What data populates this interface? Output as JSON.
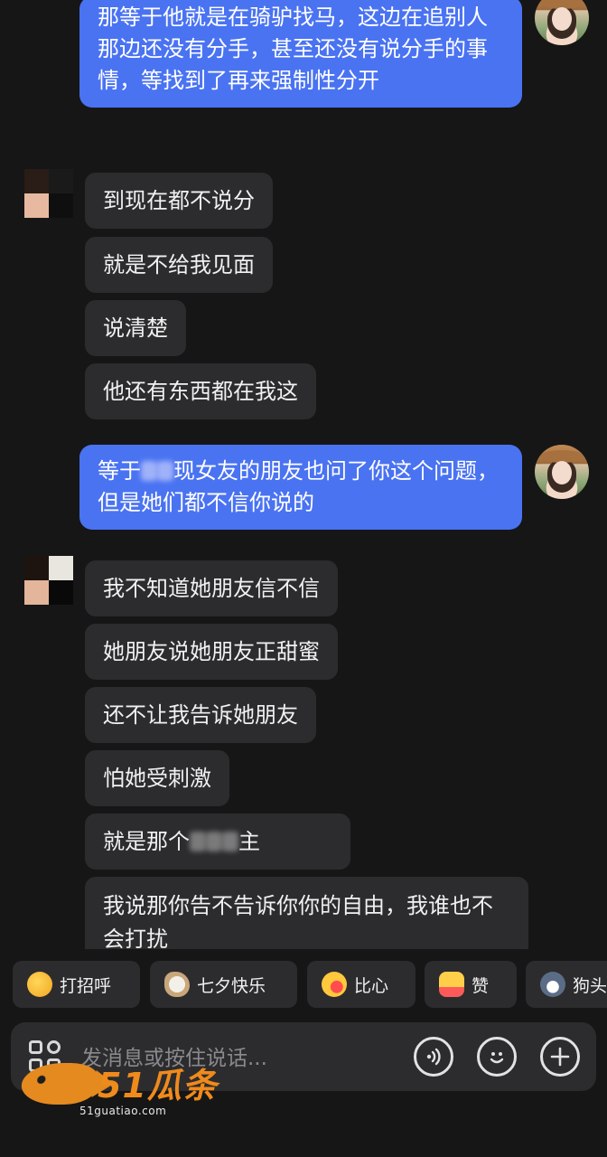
{
  "messages": [
    {
      "side": "out",
      "text": "那等于他就是在骑驴找马，这边在追别人那边还没有分手，甚至还没有说分手的事情，等找到了再来强制性分开"
    },
    {
      "side": "in",
      "text": "到现在都不说分"
    },
    {
      "side": "in",
      "text": "就是不给我见面"
    },
    {
      "side": "in",
      "text": "说清楚"
    },
    {
      "side": "in",
      "text": "他还有东西都在我这"
    },
    {
      "side": "out",
      "text_before": "等于",
      "text_after": "现女友的朋友也问了你这个问题，但是她们都不信你说的"
    },
    {
      "side": "in",
      "text": "我不知道她朋友信不信"
    },
    {
      "side": "in",
      "text": "她朋友说她朋友正甜蜜"
    },
    {
      "side": "in",
      "text": "还不让我告诉她朋友"
    },
    {
      "side": "in",
      "text": "怕她受刺激"
    },
    {
      "side": "in",
      "text_before": "就是那个",
      "text_after": "主"
    },
    {
      "side": "in",
      "text": "我说那你告不告诉你你的自由，我谁也不会打扰"
    }
  ],
  "quick_replies": [
    {
      "label": "打招呼",
      "icon": "smile-wave-icon"
    },
    {
      "label": "七夕快乐",
      "icon": "bird-icon"
    },
    {
      "label": "比心",
      "icon": "heart-hand-icon"
    },
    {
      "label": "赞",
      "icon": "thumbs-up-icon"
    },
    {
      "label": "狗头",
      "icon": "dog-head-icon"
    }
  ],
  "input": {
    "placeholder": "发消息或按住说话..."
  },
  "watermark": {
    "brand": "51瓜条",
    "domain": "51guatiao.com"
  },
  "colors": {
    "background": "#161616",
    "outgoing_bubble": "#4a73f2",
    "incoming_bubble": "#2c2c2e",
    "watermark": "#ef8a1c"
  }
}
